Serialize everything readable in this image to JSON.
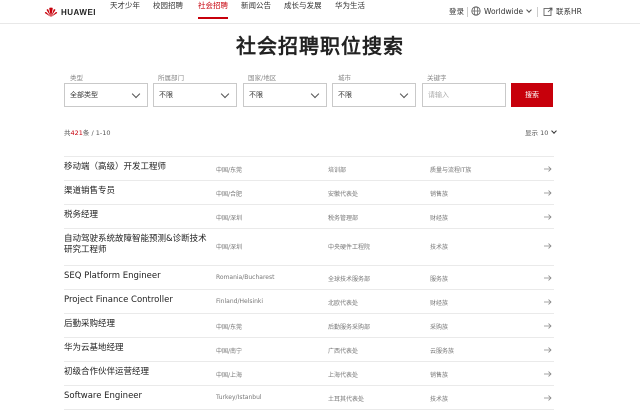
{
  "header": {
    "brand": "HUAWEI",
    "nav": [
      {
        "label": "天才少年",
        "active": false
      },
      {
        "label": "校园招聘",
        "active": false
      },
      {
        "label": "社会招聘",
        "active": true
      },
      {
        "label": "新闻公告",
        "active": false
      },
      {
        "label": "成长与发展",
        "active": false
      },
      {
        "label": "华为生活",
        "active": false
      }
    ],
    "login": "登录",
    "region": "Worldwide",
    "contact": "联系HR"
  },
  "title": "社会招聘职位搜索",
  "filters": {
    "type_label": "类型",
    "type_value": "全部类型",
    "dept_label": "所属部门",
    "dept_value": "不限",
    "country_label": "国家/地区",
    "country_value": "不限",
    "city_label": "城市",
    "city_value": "不限",
    "keyword_label": "关键字",
    "keyword_placeholder": "请输入",
    "search_label": "搜索"
  },
  "results": {
    "prefix": "共",
    "total": "421",
    "suffix": "条 / 1-10",
    "display_label": "显示",
    "display_value": "10"
  },
  "jobs": [
    {
      "title": "移动端（高级）开发工程师",
      "location": "中国/东莞",
      "dept": "培训部",
      "category": "质量与流程IT族"
    },
    {
      "title": "渠道销售专员",
      "location": "中国/合肥",
      "dept": "安徽代表处",
      "category": "销售族"
    },
    {
      "title": "税务经理",
      "location": "中国/深圳",
      "dept": "税务管理部",
      "category": "财经族"
    },
    {
      "title": "自动驾驶系统故障智能预测&诊断技术研究工程师",
      "location": "中国/深圳",
      "dept": "中央硬件工程院",
      "category": "技术族"
    },
    {
      "title": "SEQ Platform Engineer",
      "location": "Romania/Bucharest",
      "dept": "全球技术服务部",
      "category": "服务族"
    },
    {
      "title": "Project Finance Controller",
      "location": "Finland/Helsinki",
      "dept": "北欧代表处",
      "category": "财经族"
    },
    {
      "title": "后勤采购经理",
      "location": "中国/东莞",
      "dept": "后勤服务采购部",
      "category": "采购族"
    },
    {
      "title": "华为云基地经理",
      "location": "中国/南宁",
      "dept": "广西代表处",
      "category": "云服务族"
    },
    {
      "title": "初级合作伙伴运营经理",
      "location": "中国/上海",
      "dept": "上海代表处",
      "category": "销售族"
    },
    {
      "title": "Software Engineer",
      "location": "Turkey/Istanbul",
      "dept": "土耳其代表处",
      "category": "技术族"
    }
  ],
  "colors": {
    "accent": "#c7000b"
  }
}
